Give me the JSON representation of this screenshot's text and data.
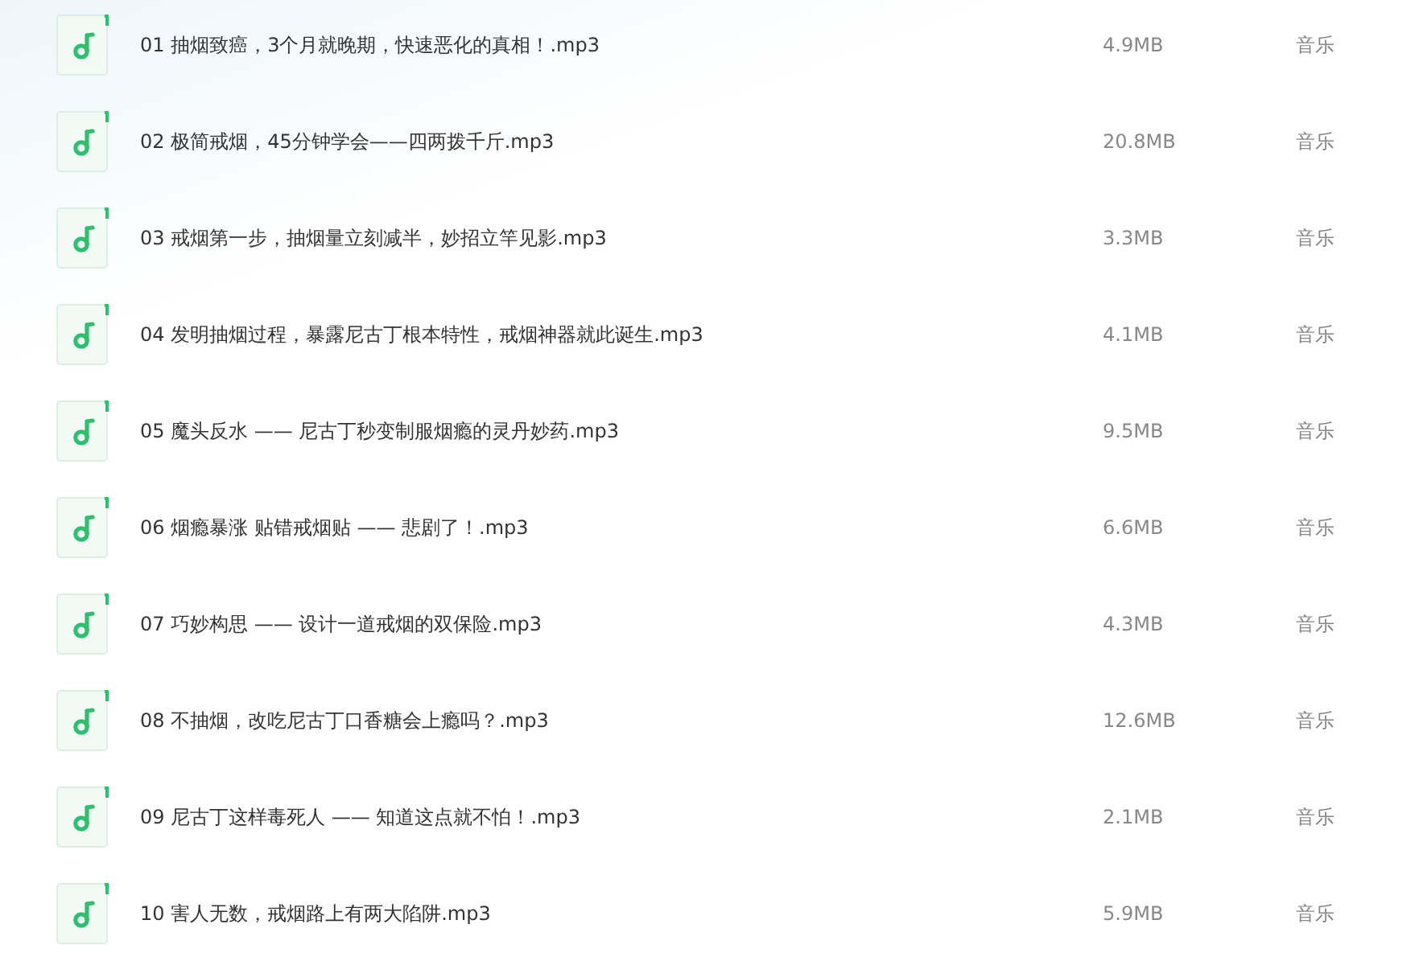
{
  "files": [
    {
      "name": "01 抽烟致癌，3个月就晚期，快速恶化的真相！.mp3",
      "size": "4.9MB",
      "type": "音乐"
    },
    {
      "name": "02 极简戒烟，45分钟学会——四两拨千斤.mp3",
      "size": "20.8MB",
      "type": "音乐"
    },
    {
      "name": "03 戒烟第一步，抽烟量立刻减半，妙招立竿见影.mp3",
      "size": "3.3MB",
      "type": "音乐"
    },
    {
      "name": "04 发明抽烟过程，暴露尼古丁根本特性，戒烟神器就此诞生.mp3",
      "size": "4.1MB",
      "type": "音乐"
    },
    {
      "name": "05 魔头反水 —— 尼古丁秒变制服烟瘾的灵丹妙药.mp3",
      "size": "9.5MB",
      "type": "音乐"
    },
    {
      "name": "06 烟瘾暴涨 贴错戒烟贴 —— 悲剧了！.mp3",
      "size": "6.6MB",
      "type": "音乐"
    },
    {
      "name": "07 巧妙构思 —— 设计一道戒烟的双保险.mp3",
      "size": "4.3MB",
      "type": "音乐"
    },
    {
      "name": "08 不抽烟，改吃尼古丁口香糖会上瘾吗？.mp3",
      "size": "12.6MB",
      "type": "音乐"
    },
    {
      "name": "09 尼古丁这样毒死人 —— 知道这点就不怕！.mp3",
      "size": "2.1MB",
      "type": "音乐"
    },
    {
      "name": "10 害人无数，戒烟路上有两大陷阱.mp3",
      "size": "5.9MB",
      "type": "音乐"
    }
  ]
}
